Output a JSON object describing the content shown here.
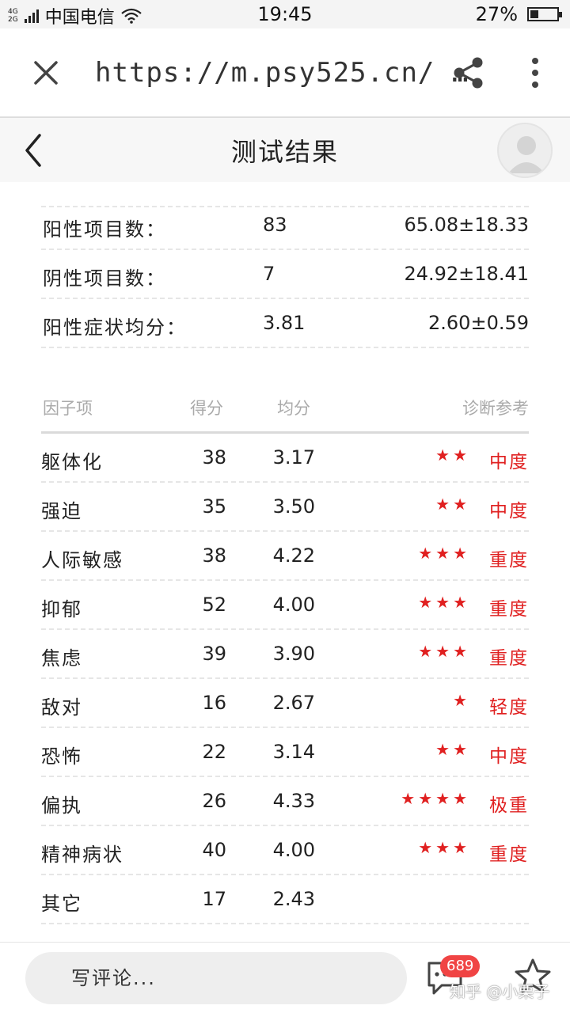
{
  "status_bar": {
    "network_top": "4G",
    "network_bottom": "2G",
    "carrier": "中国电信",
    "time": "19:45",
    "battery_percent": "27%",
    "battery_level": 0.27
  },
  "browser": {
    "url": "https://m.psy525.cn/ …",
    "icons": {
      "close": "close-icon",
      "share": "share-icon",
      "more": "more-vertical-icon"
    }
  },
  "header": {
    "title": "测试结果",
    "icons": {
      "back": "chevron-left-icon",
      "avatar": "user-avatar-icon"
    }
  },
  "summary": [
    {
      "label": "阳性项目数：",
      "value": "83",
      "reference": "65.08±18.33"
    },
    {
      "label": "阴性项目数：",
      "value": "7",
      "reference": "24.92±18.41"
    },
    {
      "label": "阳性症状均分：",
      "value": "3.81",
      "reference": "2.60±0.59"
    }
  ],
  "factor_table": {
    "headers": {
      "factor": "因子项",
      "score": "得分",
      "average": "均分",
      "diagnosis": "诊断参考"
    },
    "rows": [
      {
        "name": "躯体化",
        "score": "38",
        "average": "3.17",
        "stars": "★★",
        "level": "中度"
      },
      {
        "name": "强迫",
        "score": "35",
        "average": "3.50",
        "stars": "★★",
        "level": "中度"
      },
      {
        "name": "人际敏感",
        "score": "38",
        "average": "4.22",
        "stars": "★★★",
        "level": "重度"
      },
      {
        "name": "抑郁",
        "score": "52",
        "average": "4.00",
        "stars": "★★★",
        "level": "重度"
      },
      {
        "name": "焦虑",
        "score": "39",
        "average": "3.90",
        "stars": "★★★",
        "level": "重度"
      },
      {
        "name": "敌对",
        "score": "16",
        "average": "2.67",
        "stars": "★",
        "level": "轻度"
      },
      {
        "name": "恐怖",
        "score": "22",
        "average": "3.14",
        "stars": "★★",
        "level": "中度"
      },
      {
        "name": "偏执",
        "score": "26",
        "average": "4.33",
        "stars": "★★★★",
        "level": "极重"
      },
      {
        "name": "精神病状",
        "score": "40",
        "average": "4.00",
        "stars": "★★★",
        "level": "重度"
      },
      {
        "name": "其它",
        "score": "17",
        "average": "2.43",
        "stars": "",
        "level": ""
      }
    ]
  },
  "bottom_bar": {
    "comment_placeholder": "写评论...",
    "comment_count": "689",
    "watermark": "知乎 @小栗子",
    "icons": {
      "comment": "comment-icon",
      "favorite": "star-outline-icon"
    }
  },
  "colors": {
    "accent_red": "#e02020",
    "badge_red": "#f04444"
  }
}
